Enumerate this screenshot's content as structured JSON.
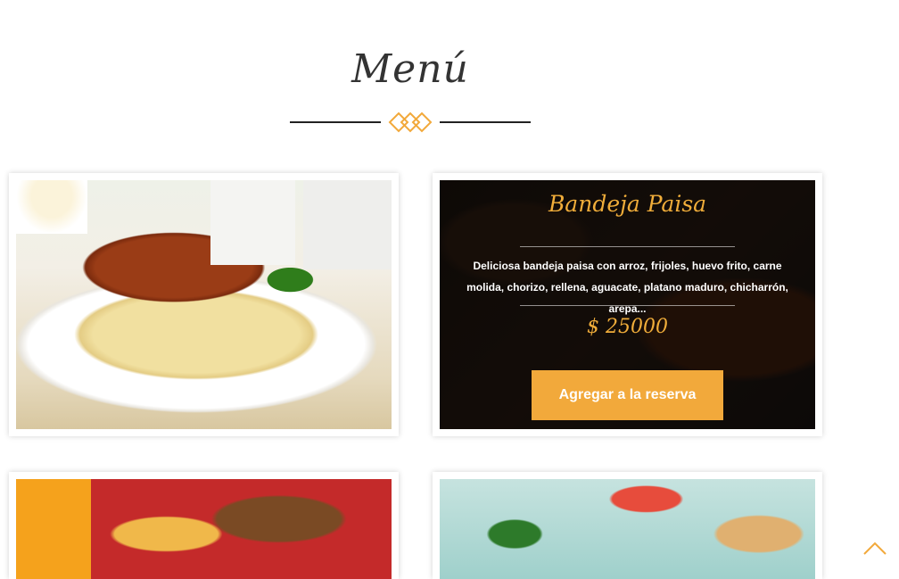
{
  "section": {
    "title": "Menú"
  },
  "colors": {
    "accent": "#f2a93b",
    "dark": "#222222"
  },
  "menu": {
    "items": [
      {
        "image": "spaghetti-bolognese"
      },
      {
        "name": "Bandeja Paisa",
        "description": "Deliciosa bandeja paisa con arroz, frijoles, huevo frito, carne molida, chorizo, rellena, aguacate, platano maduro, chicharrón, arepa...",
        "price": "$ 25000",
        "button_label": "Agregar a la reserva"
      },
      {
        "image": "chicken-plate"
      },
      {
        "image": "hotdog-salad"
      }
    ]
  },
  "icons": {
    "divider": "diamond-ornament-icon",
    "scroll": "chevron-up-icon"
  }
}
